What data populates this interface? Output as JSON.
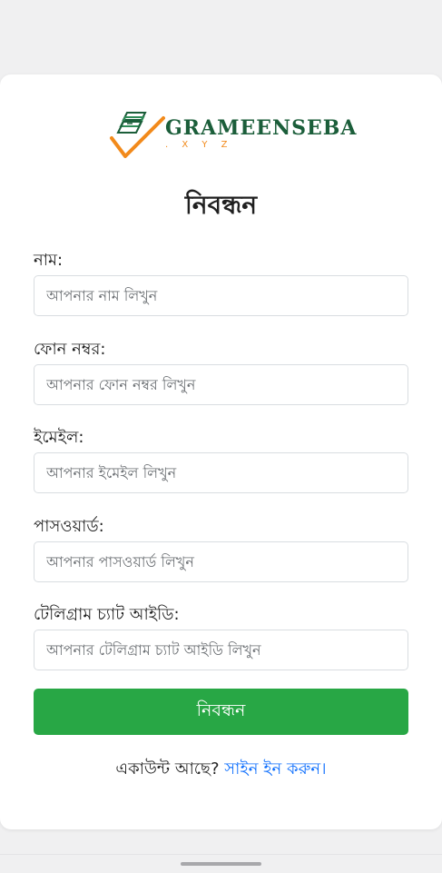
{
  "brand": {
    "name": "GRAMEENSEBA",
    "suffix": ". X Y Z",
    "colors": {
      "primary_green": "#1b5e3a",
      "accent_orange": "#f28a1b",
      "button_green": "#28a745",
      "link_blue": "#0d6efd"
    }
  },
  "form": {
    "title": "নিবন্ধন",
    "fields": [
      {
        "label": "নাম:",
        "placeholder": "আপনার নাম লিখুন"
      },
      {
        "label": "ফোন নম্বর:",
        "placeholder": "আপনার ফোন নম্বর লিখুন"
      },
      {
        "label": "ইমেইল:",
        "placeholder": "আপনার ইমেইল লিখুন"
      },
      {
        "label": "পাসওয়ার্ড:",
        "placeholder": "আপনার পাসওয়ার্ড লিখুন"
      },
      {
        "label": "টেলিগ্রাম চ্যাট আইডি:",
        "placeholder": "আপনার টেলিগ্রাম চ্যাট আইডি লিখুন"
      }
    ],
    "submit_label": "নিবন্ধন"
  },
  "footer": {
    "prompt": "একাউন্ট আছে? ",
    "link_text": "সাইন ইন করুন।"
  }
}
